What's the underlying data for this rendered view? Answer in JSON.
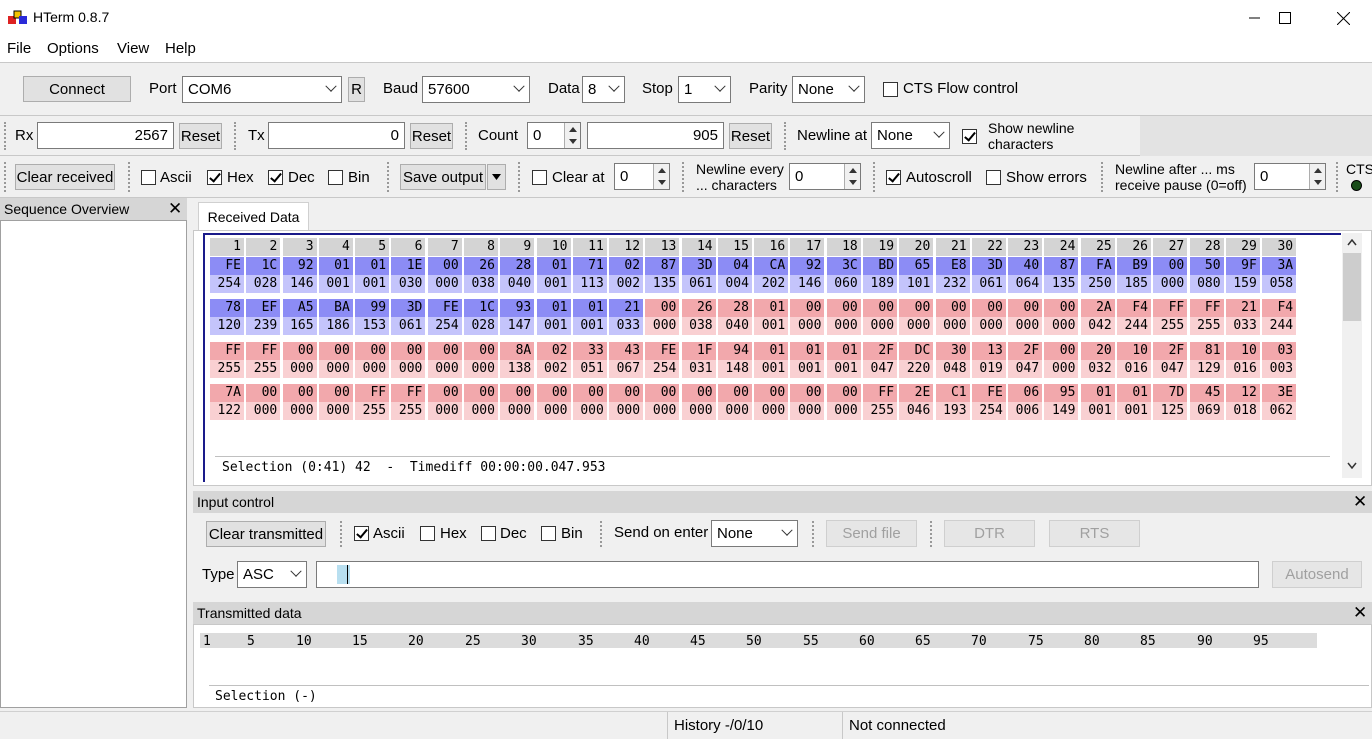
{
  "window": {
    "title": "HTerm 0.8.7"
  },
  "menu": [
    "File",
    "Options",
    "View",
    "Help"
  ],
  "connection": {
    "connect_label": "Connect",
    "port_label": "Port",
    "port_value": "COM6",
    "r_label": "R",
    "baud_label": "Baud",
    "baud_value": "57600",
    "data_label": "Data",
    "data_value": "8",
    "stop_label": "Stop",
    "stop_value": "1",
    "parity_label": "Parity",
    "parity_value": "None",
    "cts_label": "CTS Flow control"
  },
  "counters": {
    "rx_label": "Rx",
    "rx_value": "2567",
    "rx_reset": "Reset",
    "tx_label": "Tx",
    "tx_value": "0",
    "tx_reset": "Reset",
    "count_label": "Count",
    "count_value": "0",
    "count_total": "905",
    "count_reset": "Reset",
    "newline_at_label": "Newline at",
    "newline_at_value": "None",
    "show_newline_line1": "Show newline",
    "show_newline_line2": "characters"
  },
  "receive_opts": {
    "clear_received": "Clear received",
    "ascii": "Ascii",
    "hex": "Hex",
    "dec": "Dec",
    "bin": "Bin",
    "save_output": "Save output",
    "clear_at": "Clear at",
    "clear_at_value": "0",
    "newline_every_1": "Newline every",
    "newline_every_2": "... characters",
    "newline_every_value": "0",
    "autoscroll": "Autoscroll",
    "show_errors": "Show errors",
    "newline_after_1": "Newline after ... ms",
    "newline_after_2": "receive pause (0=off)",
    "newline_after_value": "0",
    "cts": "CTS"
  },
  "sequence_overview": {
    "title": "Sequence Overview"
  },
  "received": {
    "tab": "Received Data",
    "columns": [
      "1",
      "2",
      "3",
      "4",
      "5",
      "6",
      "7",
      "8",
      "9",
      "10",
      "11",
      "12",
      "13",
      "14",
      "15",
      "16",
      "17",
      "18",
      "19",
      "20",
      "21",
      "22",
      "23",
      "24",
      "25",
      "26",
      "27",
      "28",
      "29",
      "30"
    ],
    "blocks": [
      {
        "hex": [
          "FE",
          "1C",
          "92",
          "01",
          "01",
          "1E",
          "00",
          "26",
          "28",
          "01",
          "71",
          "02",
          "87",
          "3D",
          "04",
          "CA",
          "92",
          "3C",
          "BD",
          "65",
          "E8",
          "3D",
          "40",
          "87",
          "FA",
          "B9",
          "00",
          "50",
          "9F",
          "3A"
        ],
        "dec": [
          "254",
          "028",
          "146",
          "001",
          "001",
          "030",
          "000",
          "038",
          "040",
          "001",
          "113",
          "002",
          "135",
          "061",
          "004",
          "202",
          "146",
          "060",
          "189",
          "101",
          "232",
          "061",
          "064",
          "135",
          "250",
          "185",
          "000",
          "080",
          "159",
          "058"
        ],
        "sel": 30
      },
      {
        "hex": [
          "78",
          "EF",
          "A5",
          "BA",
          "99",
          "3D",
          "FE",
          "1C",
          "93",
          "01",
          "01",
          "21",
          "00",
          "26",
          "28",
          "01",
          "00",
          "00",
          "00",
          "00",
          "00",
          "00",
          "00",
          "00",
          "2A",
          "F4",
          "FF",
          "FF",
          "21",
          "F4"
        ],
        "dec": [
          "120",
          "239",
          "165",
          "186",
          "153",
          "061",
          "254",
          "028",
          "147",
          "001",
          "001",
          "033",
          "000",
          "038",
          "040",
          "001",
          "000",
          "000",
          "000",
          "000",
          "000",
          "000",
          "000",
          "000",
          "042",
          "244",
          "255",
          "255",
          "033",
          "244"
        ],
        "sel": 12
      },
      {
        "hex": [
          "FF",
          "FF",
          "00",
          "00",
          "00",
          "00",
          "00",
          "00",
          "8A",
          "02",
          "33",
          "43",
          "FE",
          "1F",
          "94",
          "01",
          "01",
          "01",
          "2F",
          "DC",
          "30",
          "13",
          "2F",
          "00",
          "20",
          "10",
          "2F",
          "81",
          "10",
          "03"
        ],
        "dec": [
          "255",
          "255",
          "000",
          "000",
          "000",
          "000",
          "000",
          "000",
          "138",
          "002",
          "051",
          "067",
          "254",
          "031",
          "148",
          "001",
          "001",
          "001",
          "047",
          "220",
          "048",
          "019",
          "047",
          "000",
          "032",
          "016",
          "047",
          "129",
          "016",
          "003"
        ],
        "sel": 0
      },
      {
        "hex": [
          "7A",
          "00",
          "00",
          "00",
          "FF",
          "FF",
          "00",
          "00",
          "00",
          "00",
          "00",
          "00",
          "00",
          "00",
          "00",
          "00",
          "00",
          "00",
          "FF",
          "2E",
          "C1",
          "FE",
          "06",
          "95",
          "01",
          "01",
          "7D",
          "45",
          "12",
          "3E"
        ],
        "dec": [
          "122",
          "000",
          "000",
          "000",
          "255",
          "255",
          "000",
          "000",
          "000",
          "000",
          "000",
          "000",
          "000",
          "000",
          "000",
          "000",
          "000",
          "000",
          "255",
          "046",
          "193",
          "254",
          "006",
          "149",
          "001",
          "001",
          "125",
          "069",
          "018",
          "062"
        ],
        "sel": 0
      }
    ],
    "selection": "Selection (0:41) 42  -  Timediff 00:00:00.047.953"
  },
  "input_control": {
    "title": "Input control",
    "clear_transmitted": "Clear transmitted",
    "ascii": "Ascii",
    "hex": "Hex",
    "dec": "Dec",
    "bin": "Bin",
    "send_on_enter_label": "Send on enter",
    "send_on_enter_value": "None",
    "send_file": "Send file",
    "dtr": "DTR",
    "rts": "RTS",
    "type_label": "Type",
    "type_value": "ASC",
    "autosend": "Autosend"
  },
  "transmitted": {
    "title": "Transmitted data",
    "ruler": [
      "1",
      "5",
      "10",
      "15",
      "20",
      "25",
      "30",
      "35",
      "40",
      "45",
      "50",
      "55",
      "60",
      "65",
      "70",
      "75",
      "80",
      "85",
      "90",
      "95"
    ],
    "selection": "Selection (-)"
  },
  "status": {
    "history": "History -/0/10",
    "connection": "Not connected"
  },
  "colors": {
    "selected_hex": "#8c8cf5",
    "selected_dec": "#c4c4fb",
    "hex": "#f2a8ac",
    "dec": "#f9d0d2"
  }
}
